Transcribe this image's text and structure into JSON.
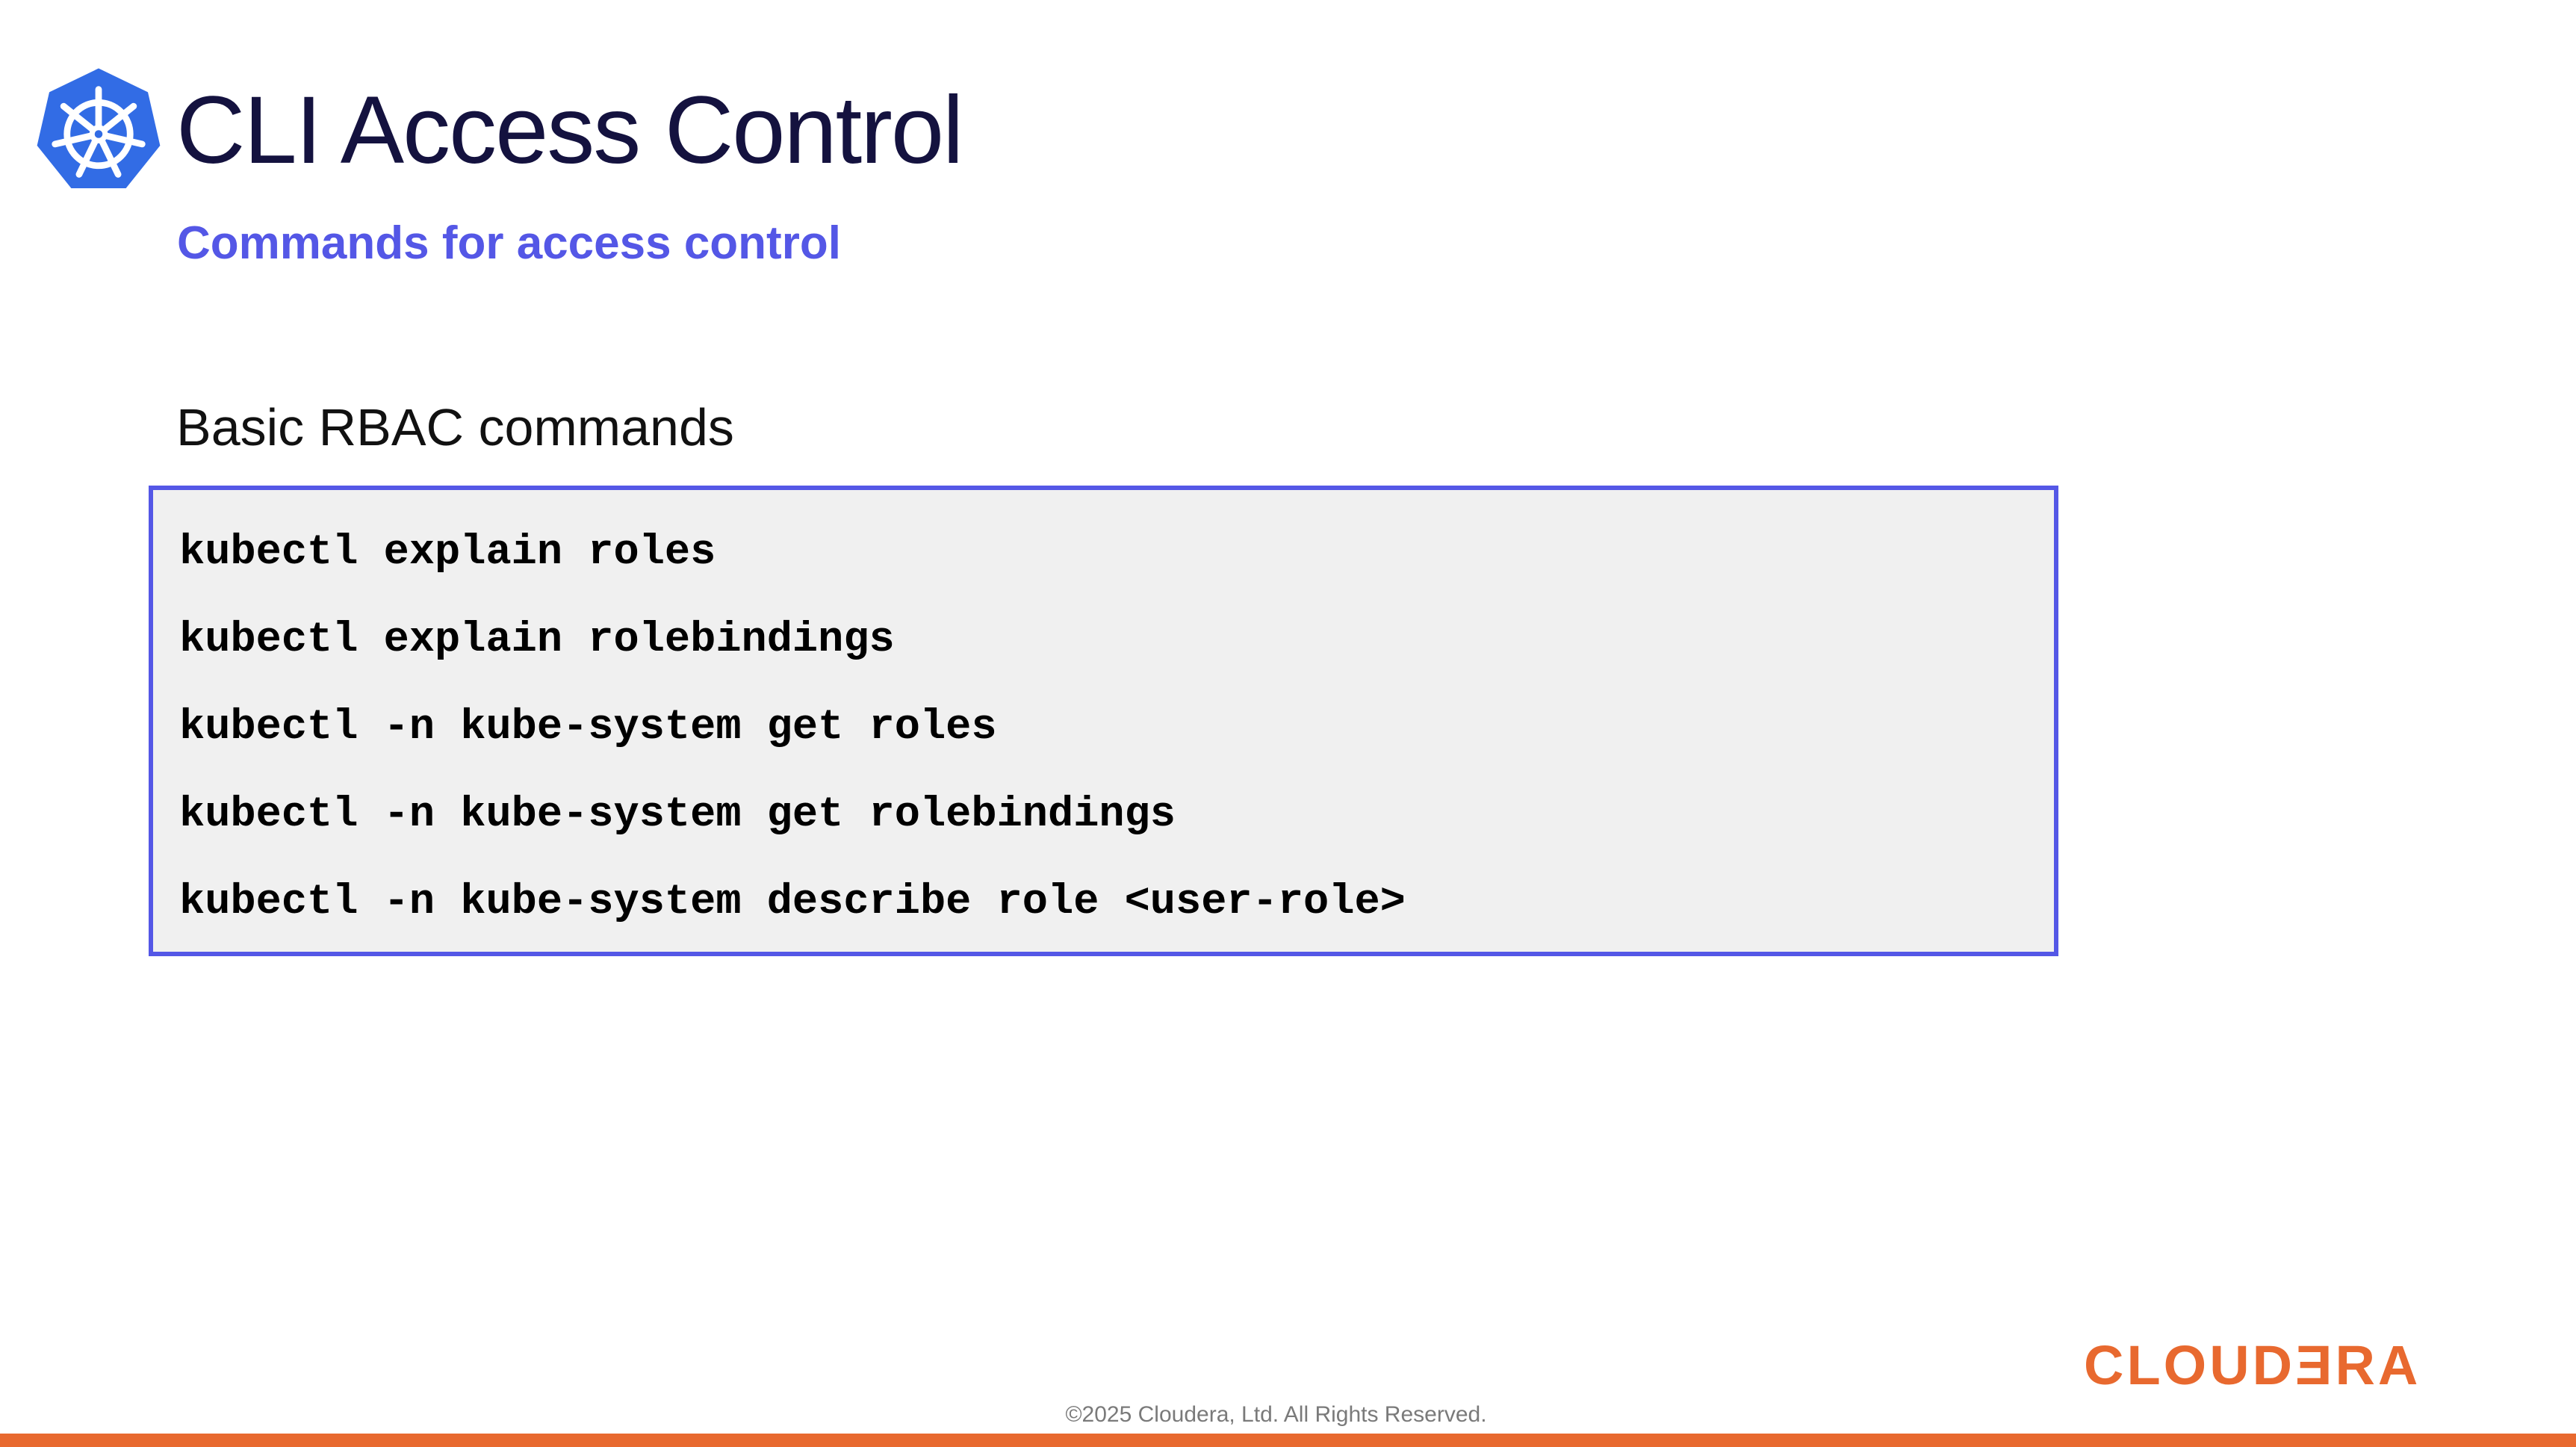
{
  "header": {
    "title": "CLI Access Control",
    "subtitle": "Commands for access control",
    "logo_icon": "kubernetes-helm-icon"
  },
  "section": {
    "heading": "Basic RBAC commands",
    "commands": [
      "kubectl explain roles",
      "kubectl explain rolebindings",
      "kubectl -n kube-system get roles",
      "kubectl -n kube-system get rolebindings",
      "kubectl -n kube-system describe role <user-role>"
    ]
  },
  "footer": {
    "brand": "CLOUDƎRA",
    "copyright": "©2025 Cloudera, Ltd. All Rights Reserved."
  },
  "colors": {
    "title": "#14123f",
    "accent": "#5457e6",
    "code_background": "#f0f0f0",
    "brand": "#e8692f",
    "kubernetes_blue": "#326ce5"
  }
}
